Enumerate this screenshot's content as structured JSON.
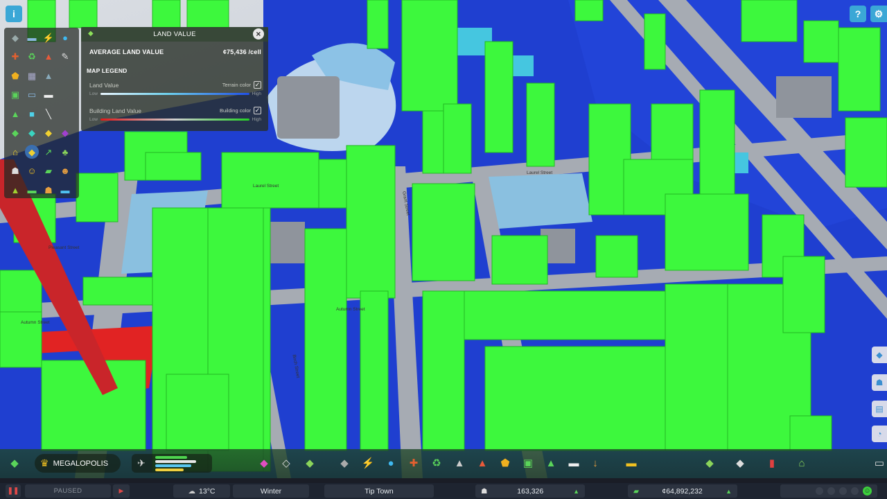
{
  "land_value_panel": {
    "title": "LAND VALUE",
    "average_label": "AVERAGE LAND VALUE",
    "average_value": "¢75,436 /cell",
    "legend_title": "MAP LEGEND",
    "land_value": {
      "label": "Land Value",
      "toggle_label": "Terrain color",
      "checked": true,
      "low": "Low",
      "high": "High"
    },
    "building_land_value": {
      "label": "Building Land Value",
      "toggle_label": "Building color",
      "checked": true,
      "low": "Low",
      "high": "High"
    },
    "close_symbol": "×"
  },
  "street_labels": [
    "Laurel Street",
    "Laurel Street",
    "Pleasant Street",
    "Autumn Street",
    "Autumn Street",
    "Birch Street",
    "Grant Street"
  ],
  "top_left_button": {
    "icon": "info-icon",
    "symbol": "i"
  },
  "top_right_buttons": [
    {
      "icon": "help-icon",
      "symbol": "?"
    },
    {
      "icon": "settings-icon",
      "symbol": "⚙"
    }
  ],
  "tool_panel_icons": [
    "road-icon",
    "bus-icon",
    "lightning-icon",
    "water-drop-icon",
    "fire-icon",
    "recycle-icon",
    "fire-truck-icon",
    "wrench-icon",
    "police-badge-icon",
    "government-icon",
    "education-icon",
    "blank",
    "park-icon",
    "tram-icon",
    "chat-icon",
    "blank",
    "tree-icon",
    "zone-icon",
    "pipe-icon",
    "blank",
    "zoning-icon",
    "land-value-icon",
    "economy-icon",
    "crop-icon",
    "residential-icon",
    "land-value-selected-icon",
    "trend-icon",
    "plant-icon",
    "people-icon",
    "happiness-icon",
    "money-icon",
    "worker-icon",
    "leaf-icon",
    "car-icon",
    "family-icon",
    "beach-icon"
  ],
  "milestone": {
    "label": "MEGALOPOLIS",
    "icon": "trophy-icon"
  },
  "progress_bars": [
    {
      "color": "#4ed44e",
      "fill": 0.62
    },
    {
      "color": "#e8e8e8",
      "fill": 0.8
    },
    {
      "color": "#59c7f0",
      "fill": 0.7
    },
    {
      "color": "#f0d040",
      "fill": 0.55
    }
  ],
  "toolbar_icons": [
    "zoning-icon",
    "area-icon",
    "landscaping-icon",
    "road-tool-icon",
    "electricity-icon",
    "water-icon",
    "healthcare-icon",
    "garbage-icon",
    "education-icon",
    "fire-rescue-icon",
    "police-icon",
    "transportation-icon",
    "parks-icon",
    "communication-icon",
    "landscaping-tool-icon",
    "bulldozer-icon",
    "economy-icon",
    "map-icon",
    "statistics-icon",
    "progression-icon"
  ],
  "status_bar": {
    "paused_label": "PAUSED",
    "temperature": "13°C",
    "season": "Winter",
    "city_name": "Tip Town",
    "population": "163,326",
    "money": "¢64,892,232"
  }
}
